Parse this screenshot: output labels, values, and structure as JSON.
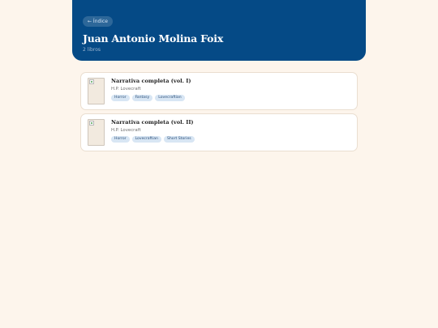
{
  "header": {
    "back_label": "← Índice",
    "author_name": "Juan Antonio Molina Foix",
    "count_text": "2 libros"
  },
  "books": [
    {
      "title": "Narrativa completa (vol. I)",
      "author": "H.P. Lovecraft",
      "tags": [
        "Horror",
        "Fantasy",
        "Lovecraftian"
      ]
    },
    {
      "title": "Narrativa completa (vol. II)",
      "author": "H.P. Lovecraft",
      "tags": [
        "Horror",
        "Lovecraftian",
        "Short Stories"
      ]
    }
  ],
  "colors": {
    "header_bg": "#054a86",
    "page_bg": "#fdf5ec",
    "tag_bg": "#d8e6f4",
    "tag_text": "#2c4f78"
  }
}
